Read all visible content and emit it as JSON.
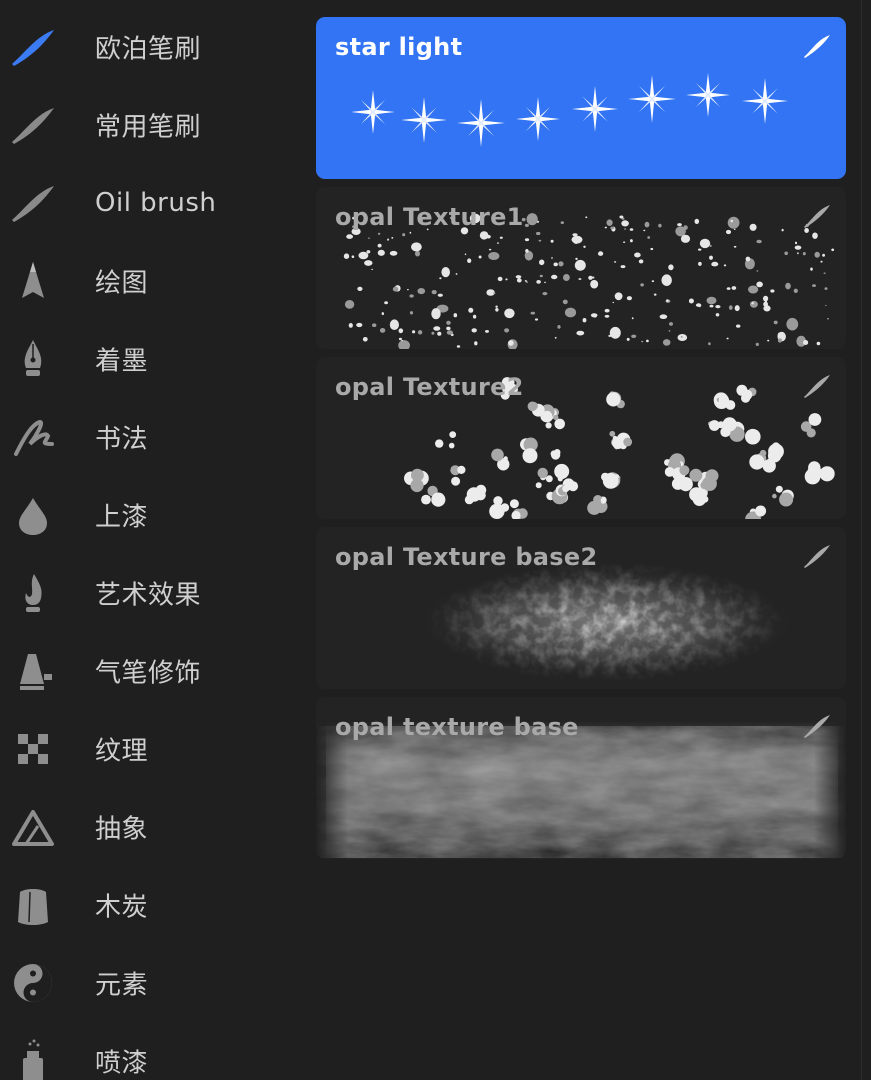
{
  "sidebar": {
    "items": [
      {
        "label": "欧泊笔刷",
        "icon": "brush-stroke-icon",
        "active": true
      },
      {
        "label": "常用笔刷",
        "icon": "brush-stroke-icon",
        "active": false
      },
      {
        "label": "Oil brush",
        "icon": "brush-stroke-icon",
        "active": false
      },
      {
        "label": "绘图",
        "icon": "pencil-tip-icon",
        "active": false
      },
      {
        "label": "着墨",
        "icon": "pen-nib-icon",
        "active": false
      },
      {
        "label": "书法",
        "icon": "calligraphy-icon",
        "active": false
      },
      {
        "label": "上漆",
        "icon": "paint-drop-icon",
        "active": false
      },
      {
        "label": "艺术效果",
        "icon": "flame-icon",
        "active": false
      },
      {
        "label": "气笔修饰",
        "icon": "airbrush-icon",
        "active": false
      },
      {
        "label": "纹理",
        "icon": "checkerboard-icon",
        "active": false
      },
      {
        "label": "抽象",
        "icon": "triangle-icon",
        "active": false
      },
      {
        "label": "木炭",
        "icon": "charcoal-icon",
        "active": false
      },
      {
        "label": "元素",
        "icon": "yin-yang-icon",
        "active": false
      },
      {
        "label": "喷漆",
        "icon": "spray-can-icon",
        "active": false
      }
    ]
  },
  "brushes": [
    {
      "name": "star light",
      "selected": true
    },
    {
      "name": "opal Texture1",
      "selected": false
    },
    {
      "name": "opal Texture2",
      "selected": false
    },
    {
      "name": "opal Texture base2",
      "selected": false
    },
    {
      "name": "opal texture base",
      "selected": false
    }
  ],
  "colors": {
    "accent": "#3274f3",
    "background": "#1f1f20",
    "card": "#232324",
    "sidebar_icon": "#8e8e8e",
    "sidebar_text": "#cfcfcf"
  }
}
